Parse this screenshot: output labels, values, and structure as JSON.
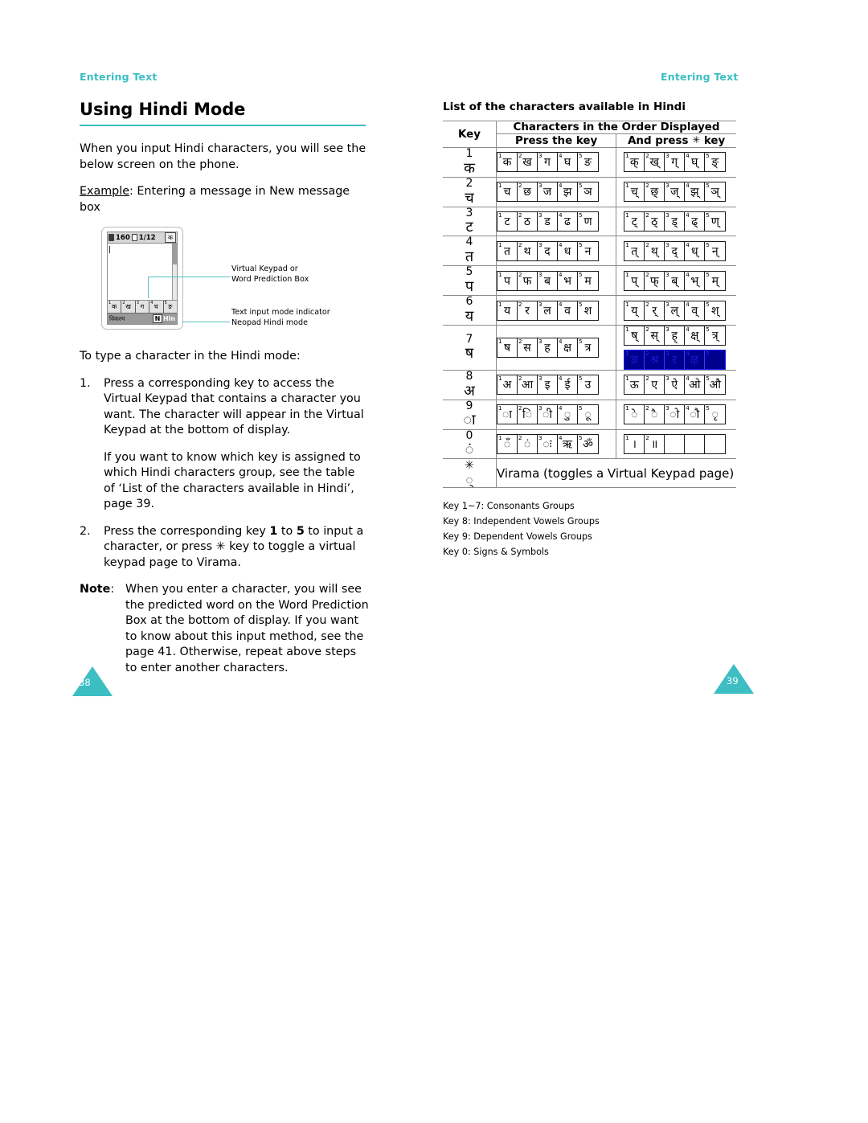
{
  "running_head": {
    "left": "Entering Text",
    "right": "Entering Text"
  },
  "colors": {
    "accent_teal": "#3cbec3",
    "callout_line": "#53c2c7",
    "highlight_navy": "#00008f"
  },
  "left_page": {
    "section_title": "Using Hindi Mode",
    "intro": "When you input Hindi characters, you will see the below screen on the phone.",
    "example_label": "Example",
    "example_rest": ": Entering a message in New message box",
    "phone": {
      "status_bar": {
        "battery_icon": "battery-icon",
        "char_count": "160",
        "message_icon": "message-icon",
        "page_counter": "1/12",
        "mode_key": "क"
      },
      "keypad_cells": [
        {
          "index": "1",
          "glyph": "क"
        },
        {
          "index": "2",
          "glyph": "ख"
        },
        {
          "index": "3",
          "glyph": "ग"
        },
        {
          "index": "4",
          "glyph": "घ"
        },
        {
          "index": "5",
          "glyph": "ङ"
        }
      ],
      "bottom_bar": {
        "soft_key_left": "विकल्प",
        "mode_n": "N",
        "mode_label": "Hin"
      }
    },
    "callouts": {
      "keypad_line1": "Virtual Keypad or",
      "keypad_line2": "Word Prediction Box",
      "mode_line1": "Text input mode indicator",
      "mode_line2": "Neopad Hindi mode"
    },
    "lead_in": "To type a character in the Hindi mode:",
    "steps": [
      {
        "num": "1.",
        "text": "Press a corresponding key to access the Virtual Keypad that contains a character you want. The character will appear in the Virtual Keypad at the bottom of display.",
        "sub": "If you want to know which key is assigned to which Hindi characters group, see the table of ‘List of the characters available in Hindi’, page 39."
      },
      {
        "num": "2.",
        "text_parts": [
          "Press the corresponding key ",
          "1",
          " to ",
          "5",
          " to input a character, or press ",
          "✳",
          " key to toggle a virtual keypad page to Virama."
        ]
      }
    ],
    "note": {
      "label": "Note",
      "colon": ":",
      "text": "When you enter a character, you will see the predicted word on the Word Prediction Box at the bottom of display. If you want to know about this input method, see the page 41. Otherwise, repeat above steps to enter another characters."
    },
    "page_number": "38"
  },
  "right_page": {
    "table_title": "List of the characters available in Hindi",
    "table_headers": {
      "key": "Key",
      "group": "Characters in the Order Displayed",
      "press": "Press the key",
      "and_press_pre": "And press",
      "and_press_star": "✳",
      "and_press_post": "key"
    },
    "rows": [
      {
        "key_num": "1",
        "key_glyph": "क",
        "press": [
          "क",
          "ख",
          "ग",
          "घ",
          "ङ"
        ],
        "star": [
          "क्",
          "ख्",
          "ग्",
          "घ्",
          "ङ्"
        ]
      },
      {
        "key_num": "2",
        "key_glyph": "च",
        "press": [
          "च",
          "छ",
          "ज",
          "झ",
          "ञ"
        ],
        "star": [
          "च्",
          "छ्",
          "ज्",
          "झ्",
          "ञ्"
        ]
      },
      {
        "key_num": "3",
        "key_glyph": "ट",
        "press": [
          "ट",
          "ठ",
          "ड",
          "ढ",
          "ण"
        ],
        "star": [
          "ट्",
          "ठ्",
          "ड्",
          "ढ्",
          "ण्"
        ]
      },
      {
        "key_num": "4",
        "key_glyph": "त",
        "press": [
          "त",
          "थ",
          "द",
          "ध",
          "न"
        ],
        "star": [
          "त्",
          "थ्",
          "द्",
          "ध्",
          "न्"
        ]
      },
      {
        "key_num": "5",
        "key_glyph": "प",
        "press": [
          "प",
          "फ",
          "ब",
          "भ",
          "म"
        ],
        "star": [
          "प्",
          "फ्",
          "ब्",
          "भ्",
          "म्"
        ]
      },
      {
        "key_num": "6",
        "key_glyph": "य",
        "press": [
          "य",
          "र",
          "ल",
          "व",
          "श"
        ],
        "star": [
          "य्",
          "र्",
          "ल्",
          "व्",
          "श्"
        ]
      },
      {
        "key_num": "7",
        "key_glyph": "ष",
        "press": [
          "ष",
          "स",
          "ह",
          "क्ष",
          "त्र"
        ],
        "star": [
          "ष्",
          "स्",
          "ह्",
          "क्ष्",
          "त्र्"
        ],
        "star_extra": [
          "ज्ञ",
          "श्र",
          "ऱ",
          "ऴ",
          ""
        ],
        "star_extra_highlighted": true
      },
      {
        "key_num": "8",
        "key_glyph": "अ",
        "press": [
          "अ",
          "आ",
          "इ",
          "ई",
          "उ"
        ],
        "star": [
          "ऊ",
          "ए",
          "ऐ",
          "ओ",
          "औ"
        ]
      },
      {
        "key_num": "9",
        "key_glyph": "ा",
        "press": [
          "ा",
          "ि",
          "ी",
          "ु",
          "ू"
        ],
        "star": [
          "े",
          "ै",
          "ो",
          "ौ",
          "ृ"
        ]
      },
      {
        "key_num": "0",
        "key_glyph": "ं",
        "press": [
          "ँ",
          "ं",
          "ः",
          "ऋ",
          "ॐ"
        ],
        "star": [
          "।",
          "॥",
          "",
          "",
          ""
        ]
      }
    ],
    "virama_row": {
      "key_num": "✳",
      "key_glyph": "्",
      "text": "Virama (toggles a Virtual Keypad page)"
    },
    "footnotes": [
      "Key 1~7: Consonants Groups",
      "Key 8: Independent Vowels Groups",
      "Key 9: Dependent Vowels Groups",
      "Key 0: Signs & Symbols"
    ],
    "page_number": "39"
  }
}
